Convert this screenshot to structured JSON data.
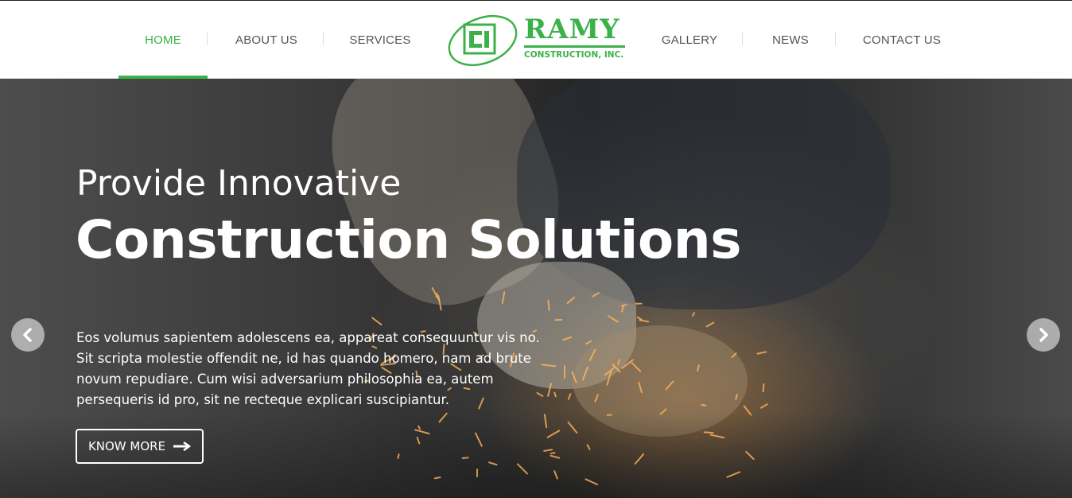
{
  "nav": {
    "left": [
      {
        "label": "HOME",
        "active": true
      },
      {
        "label": "ABOUT US",
        "active": false
      },
      {
        "label": "SERVICES",
        "active": false
      }
    ],
    "right": [
      {
        "label": "GALLERY",
        "active": false
      },
      {
        "label": "NEWS",
        "active": false
      },
      {
        "label": "CONTACT US",
        "active": false
      }
    ]
  },
  "logo": {
    "name": "RAMY",
    "subtitle": "CONSTRUCTION, INC.",
    "color": "#3cb14a"
  },
  "hero": {
    "title_line1": "Provide Innovative",
    "title_line2": "Construction Solutions",
    "text_lines": [
      "Eos volumus sapientem adolescens ea, appareat consequuntur vis no.",
      "Sit scripta molestie offendit ne, id has quando homero, nam ad brute",
      "novum repudiare. Cum wisi adversarium philosophia ea, autem",
      "persequeris id pro, sit ne recteque explicari suscipiantur."
    ],
    "button_label": "KNOW MORE",
    "button_icon": "arrow-right-icon",
    "prev_icon": "chevron-left-icon",
    "next_icon": "chevron-right-icon"
  },
  "colors": {
    "accent": "#3cb14a",
    "nav_text": "#555555"
  }
}
